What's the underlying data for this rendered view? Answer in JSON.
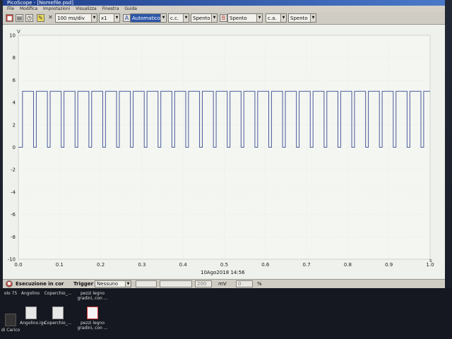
{
  "window": {
    "title": "PicoScope - [Nomefile.psd]"
  },
  "menu": [
    "File",
    "Modifica",
    "Impostazioni",
    "Visualizza",
    "Finestra",
    "Guida"
  ],
  "toolbar": {
    "timebase": "100 ms/div",
    "multiplier": "x1",
    "trigger_mode": "Automatico",
    "coupling_a": "c.c.",
    "range_a": "Spento",
    "channel_b": "Spento",
    "coupling_b": "c.a.",
    "range_b": "Spento"
  },
  "plot": {
    "y_unit": "V",
    "x_unit": "s",
    "y_ticks": [
      "10",
      "8",
      "6",
      "4",
      "2",
      "0",
      "-2",
      "-4",
      "-6",
      "-8",
      "-10"
    ],
    "x_ticks": [
      "0.0",
      "0.1",
      "0.2",
      "0.3",
      "0.4",
      "0.5",
      "0.6",
      "0.7",
      "0.8",
      "0.9",
      "1.0"
    ],
    "timestamp": "10Ago2018  14:56",
    "trace_color": "#4a5a9c"
  },
  "chart_data": {
    "type": "line",
    "title": "",
    "xlabel": "s",
    "ylabel": "V",
    "xlim": [
      0,
      1
    ],
    "ylim": [
      -10,
      10
    ],
    "grid": true,
    "series": [
      {
        "waveform": "square",
        "start_x": 0.01,
        "period": 0.0336,
        "duty": 0.8,
        "high": 5.0,
        "low": 0.0,
        "end_x": 1.0
      }
    ]
  },
  "statusbar": {
    "running": "Esecuzione in cor",
    "trigger_label": "Trigger",
    "trigger_value": "Nessuno",
    "level_value": "200",
    "level_unit": "mV",
    "pct_value": "0",
    "pct_unit": "%"
  },
  "desktop": {
    "row1": [
      "olo 75",
      "Angolino",
      "Coperchio_...",
      "pezzi legno gradini, con ..."
    ],
    "row2": [
      "di Carico",
      "Angolino.igs",
      "Coperchio_...",
      "pezzi legno gradini, con ..."
    ]
  }
}
